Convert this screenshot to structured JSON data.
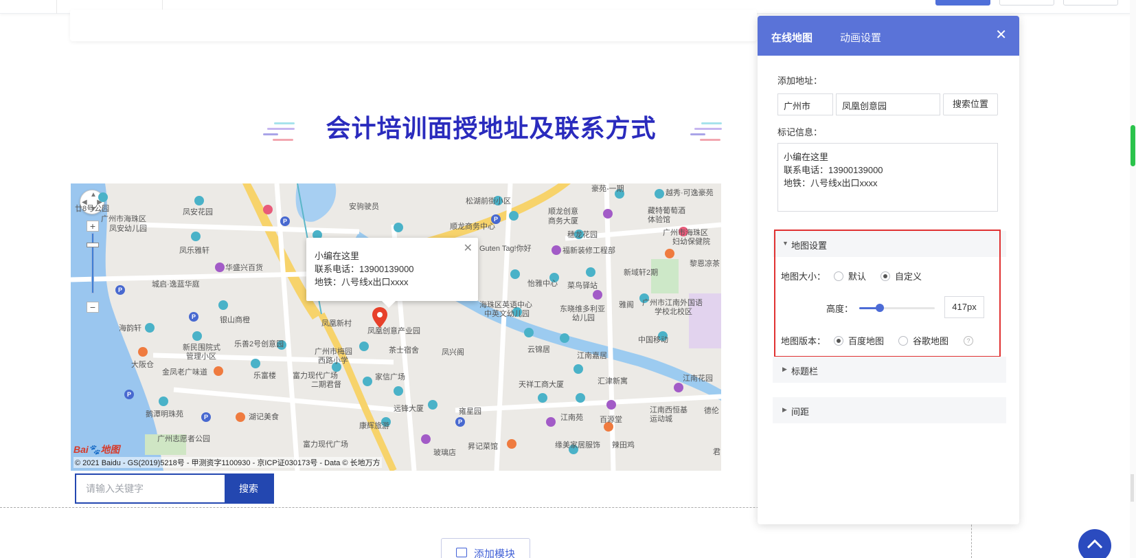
{
  "section": {
    "title": "会计培训面授地址及联系方式"
  },
  "map": {
    "info_window": {
      "line1": "小编在这里",
      "line2": "联系电话：13900139000",
      "line3": "地铁：八号线x出口xxxx"
    },
    "labels": [
      "廿8号公园",
      "广州市海珠区",
      "凤安幼儿园",
      "凤安花园",
      "凤乐雅轩",
      "华盛兴百货",
      "城启·逸蓝华庭",
      "银山商橙",
      "海韵轩",
      "新民围院式",
      "管理小区",
      "乐善2号创意园",
      "大阪仓",
      "金凤老广味道",
      "乐富楼",
      "鹅潭明珠苑",
      "湖记美食",
      "广州志愿者公园",
      "富力现代广场",
      "二期君督",
      "广州市梅园",
      "西路小学",
      "凤凰新村",
      "凤凰创意产业园",
      "茶士宿舍",
      "家信广场",
      "远锋大厦",
      "康辉旅游",
      "富力现代广场",
      "玻璃店",
      "安驹驶员",
      "松湖前街小区",
      "顺龙商务中心",
      "顺龙创意",
      "商务大厦",
      "穗龙花园",
      "Guten Tag!你好",
      "福新装修工程部",
      "怡雅中心",
      "菜鸟驿站",
      "海珠区英语中心",
      "中英文幼儿园",
      "东晓维多利亚",
      "幼儿园",
      "凤兴阁",
      "云锦居",
      "江南嘉居",
      "天祥工商大厦",
      "汇津新寓",
      "雍星园",
      "昇记菜馆",
      "江南苑",
      "百源堂",
      "缘美家居服饰",
      "辣田鸡",
      "江南西恒基",
      "运动城",
      "豪苑-一期",
      "越秀·可逸豪苑",
      "藏特葡萄酒",
      "体验馆",
      "广州市海珠区",
      "妇幼保健院",
      "黎恩凉茶",
      "新域轩2期",
      "雅阁",
      "广州市江南外国语",
      "学校北校区",
      "中国移动",
      "江南花园",
      "德伦",
      "君"
    ],
    "copyright": "© 2021 Baidu - GS(2019)5218号 - 甲测资字1100930 - 京ICP证030173号 - Data © 长地万方",
    "logo_text": "Bai du 地图"
  },
  "map_search": {
    "placeholder": "请输入关键字",
    "button": "搜索"
  },
  "add_module": {
    "label": "添加模块"
  },
  "panel": {
    "tabs": [
      "在线地图",
      "动画设置"
    ],
    "address_label": "添加地址：",
    "city": "广州市",
    "place": "凤凰创意园",
    "search_button": "搜索位置",
    "mark_label": "标记信息：",
    "mark_lines": [
      "小编在这里",
      "联系电话：13900139000",
      "地铁：八号线x出口xxxx"
    ],
    "sections": {
      "map_settings": "地图设置",
      "title_bar": "标题栏",
      "spacing": "间距"
    },
    "map_size": {
      "label": "地图大小：",
      "options": [
        "默认",
        "自定义"
      ],
      "selected": "自定义"
    },
    "height": {
      "label": "高度：",
      "value": "417px",
      "slider_fraction": 0.27
    },
    "map_version": {
      "label": "地图版本：",
      "options": [
        "百度地图",
        "谷歌地图"
      ],
      "selected": "百度地图",
      "help": "?"
    }
  },
  "colors": {
    "title": "#2a2bbd",
    "panel_header": "#5a73d8",
    "primary_button": "#2347b0",
    "highlight_border": "#e03030"
  }
}
